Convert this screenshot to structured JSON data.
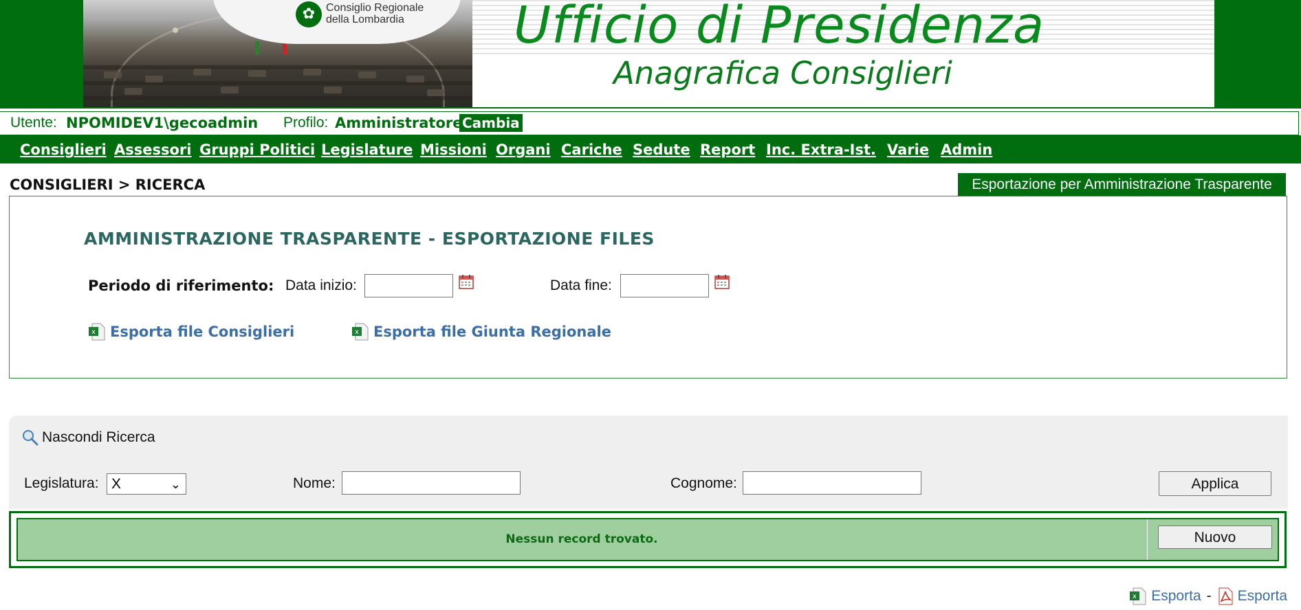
{
  "banner": {
    "logo_line1": "Consiglio Regionale",
    "logo_line2": "della Lombardia",
    "title": "Ufficio di Presidenza",
    "subtitle": "Anagrafica Consiglieri"
  },
  "userbar": {
    "user_label": "Utente:",
    "user_value": "NPOMIDEV1\\gecoadmin",
    "profile_label": "Profilo:",
    "profile_value": "Amministratore",
    "change_label": "Cambia"
  },
  "nav": {
    "items": [
      "Consiglieri",
      "Assessori",
      "Gruppi Politici",
      "Legislature",
      "Missioni",
      "Organi",
      "Cariche",
      "Sedute",
      "Report",
      "Inc. Extra-Ist.",
      "Varie",
      "Admin"
    ]
  },
  "breadcrumb": "CONSIGLIERI > RICERCA",
  "trasparente_tab": "Esportazione per Amministrazione Trasparente",
  "export_panel": {
    "title": "AMMINISTRAZIONE TRASPARENTE - ESPORTAZIONE FILES",
    "period_label": "Periodo di riferimento:",
    "start_label": "Data inizio:",
    "start_value": "",
    "end_label": "Data fine:",
    "end_value": "",
    "link_consiglieri": "Esporta file Consiglieri",
    "link_giunta": "Esporta file Giunta Regionale"
  },
  "search": {
    "toggle_label": "Nascondi Ricerca",
    "legislatura_label": "Legislatura:",
    "legislatura_value": "X",
    "nome_label": "Nome:",
    "nome_value": "",
    "cognome_label": "Cognome:",
    "cognome_value": "",
    "apply_label": "Applica"
  },
  "results": {
    "empty_message": "Nessun record trovato.",
    "new_label": "Nuovo"
  },
  "footer": {
    "export_excel": "Esporta",
    "separator": "-",
    "export_pdf": "Esporta"
  },
  "colors": {
    "brand_green": "#006e0f",
    "result_green": "#9fcf9f",
    "link_blue": "#3a6ea5"
  }
}
